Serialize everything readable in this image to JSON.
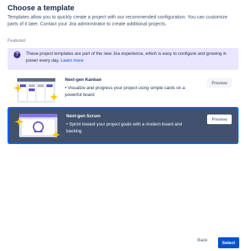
{
  "dialog": {
    "title": "Choose a template",
    "description": "Templates allow you to quickly create a project with our recommended configuration. You can customize parts of it later. Contact your Jira administrator to create additional projects."
  },
  "featured": {
    "label": "Featured",
    "banner": {
      "icon": "question-circle-icon",
      "text": "These project templates are part of the new Jira experience, which is easy to configure and growing in power every day.",
      "link": "Learn more"
    }
  },
  "templates": [
    {
      "name": "Next-gen Kanban",
      "bullet": "Visualize and progress your project using simple cards on a powerful board",
      "preview_label": "Preview",
      "selected": false
    },
    {
      "name": "Next-gen Scrum",
      "bullet": "Sprint toward your project goals with a modern board and backlog",
      "preview_label": "Preview",
      "selected": true
    }
  ],
  "footer": {
    "back_label": "Back",
    "select_label": "Select"
  },
  "colors": {
    "primary": "#0052cc",
    "banner_bg": "#eae6ff",
    "selected_card_bg": "#42526e",
    "selected_border": "#0065ff"
  }
}
